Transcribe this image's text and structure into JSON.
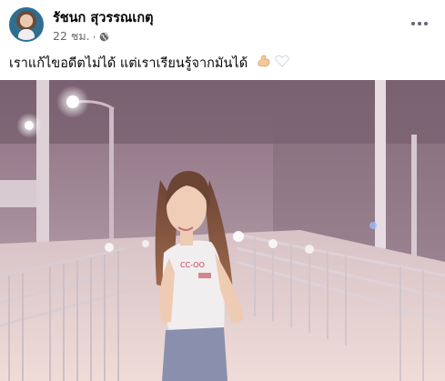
{
  "post": {
    "author_name": "รัชนก สุวรรณเกตุ",
    "timestamp": "22 ชม.",
    "separator": "·",
    "privacy_icon": "globe-icon",
    "menu_icon": "more-options-icon",
    "caption": "เราแก้ไขอดีตไม่ได้ แต่เราเรียนรู้จากมันได้",
    "caption_emojis": [
      "flexed-biceps-emoji",
      "white-heart-emoji"
    ],
    "photo": {
      "description_icon": "photo",
      "shirt_text": "CC-OO"
    }
  },
  "colors": {
    "text_primary": "#050505",
    "text_secondary": "#65676b",
    "avatar_ring": "#2d6f95"
  }
}
